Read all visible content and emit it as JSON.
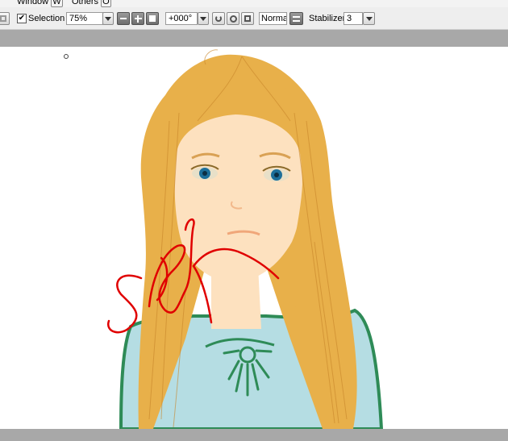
{
  "menu": {
    "items": [
      {
        "label": "Window",
        "key": "W"
      },
      {
        "label": "Others",
        "key": "O"
      }
    ]
  },
  "toolbar": {
    "selection_label": "Selection",
    "selection_checked": true,
    "zoom_value": "75%",
    "rotation_value": "+000°",
    "blend_mode": "Normal",
    "stabilizer_label": "Stabilizer",
    "stabilizer_value": "3"
  },
  "colors": {
    "chrome": "#eeeeee",
    "canvas_border": "#a8a8a8",
    "hair": "#e8b04a",
    "skin": "#fde1bf",
    "dress": "#b5dde3",
    "dress_trim": "#2e8b57",
    "signature": "#e00000",
    "eyes": "#1c6f9a"
  }
}
